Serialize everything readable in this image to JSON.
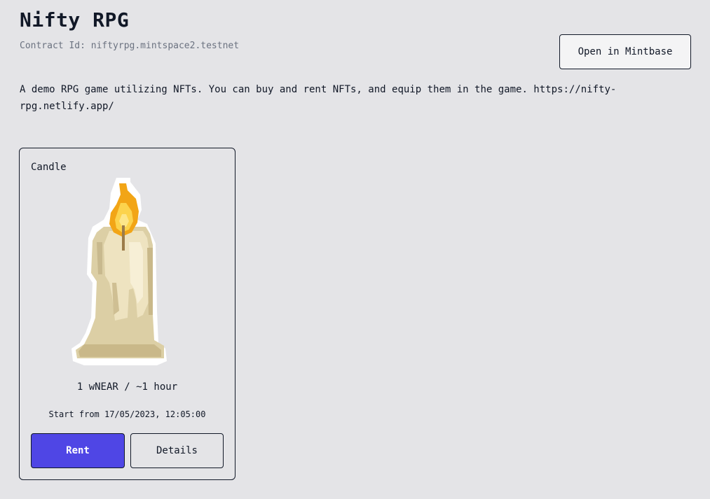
{
  "header": {
    "title": "Nifty RPG",
    "contract_id": "Contract Id: niftyrpg.mintspace2.testnet",
    "open_button_label": "Open in Mintbase"
  },
  "description": "A demo RPG game utilizing NFTs. You can buy and rent NFTs, and equip them in the game. https://nifty-rpg.netlify.app/",
  "cards": [
    {
      "name": "Candle",
      "image_icon": "candle-icon",
      "price": "1 wNEAR / ~1 hour",
      "start": "Start from 17/05/2023, 12:05:00",
      "rent_label": "Rent",
      "details_label": "Details"
    }
  ],
  "colors": {
    "background": "#e4e4e7",
    "accent": "#4f46e5",
    "text": "#111827",
    "muted": "#6b7280"
  }
}
